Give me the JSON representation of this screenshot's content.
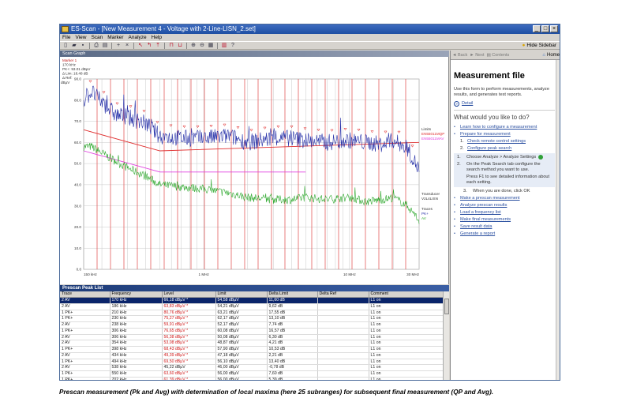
{
  "window": {
    "title": "ES-Scan - [New Measurement 4 - Voltage with 2-Line-LISN_2.set]",
    "menu": [
      "File",
      "View",
      "Scan",
      "Marker",
      "Analyze",
      "Help"
    ],
    "hide_sidebar": "Hide Sidebar"
  },
  "scan_graph": {
    "title": "Scan Graph",
    "marker": {
      "name": "Marker 1",
      "freq": "170 kHz",
      "value": "PK+: 93.01 dBµV",
      "delta": "Δ Lim: 18.48 dB",
      "ref": "Δ Ref:"
    },
    "y_unit": "dBµV",
    "limits_title": "Limits",
    "limit1": "EN55011MQP",
    "limit2": "EN55011MAV",
    "transducer_title": "Transducer",
    "transducer_name": "V2L4LISN",
    "traces_title": "Traces",
    "trace1": "PK+",
    "trace2": "AV",
    "colors": {
      "pk": "#2630a8",
      "av": "#2ea82e",
      "limit_qp": "#e03030",
      "limit_av": "#e040e0",
      "subrange": "#e04848",
      "grid": "#c8c8c8"
    }
  },
  "chart_data": {
    "type": "line",
    "xlabel": "",
    "ylabel": "dBµV",
    "x_scale": "log",
    "xlim": [
      150000,
      30000000
    ],
    "ylim": [
      0,
      90
    ],
    "x_ticks": [
      "150 kHz",
      "1 MHz",
      "10 MHz",
      "30 MHz"
    ],
    "y_ticks": [
      "0.0",
      "10.0",
      "20.0",
      "30.0",
      "40.0",
      "50.0",
      "60.0",
      "70.0",
      "80.0",
      "90.0"
    ],
    "series": [
      {
        "name": "PK+",
        "x": [
          150000,
          170000,
          200000,
          250000,
          300000,
          400000,
          500000,
          700000,
          1000000,
          1500000,
          2000000,
          3000000,
          4000000,
          5000000,
          7000000,
          10000000,
          13000000,
          17000000,
          20000000,
          25000000,
          30000000
        ],
        "y": [
          80,
          84,
          79,
          73,
          72,
          69,
          63,
          62,
          62,
          63,
          60,
          62,
          62,
          61,
          60,
          61,
          60,
          59,
          61,
          57,
          47
        ]
      },
      {
        "name": "AV",
        "x": [
          150000,
          170000,
          200000,
          250000,
          300000,
          400000,
          500000,
          700000,
          1000000,
          1500000,
          2000000,
          3000000,
          4000000,
          5000000,
          7000000,
          10000000,
          13000000,
          17000000,
          20000000,
          25000000,
          30000000
        ],
        "y": [
          58,
          58,
          55,
          51,
          48,
          44,
          40,
          39,
          38,
          36,
          34,
          33,
          33,
          34,
          33,
          34,
          32,
          33,
          34,
          30,
          23
        ]
      },
      {
        "name": "EN55011MQP",
        "x": [
          150000,
          500000,
          500000,
          30000000
        ],
        "y": [
          66,
          56,
          56,
          60
        ]
      },
      {
        "name": "EN55011MAV",
        "x": [
          150000,
          500000,
          500000,
          5000000
        ],
        "y": [
          56,
          46,
          46,
          46
        ]
      }
    ]
  },
  "peak_list": {
    "title": "Prescan Peak List",
    "columns": [
      "Trace",
      "Frequency",
      "Level",
      "Limit",
      "Delta Limit",
      "Delta Ref",
      "Comment"
    ],
    "rows": [
      [
        "2 AV",
        "170 kHz",
        "66,18 dBµV *",
        "54,58 dBµV",
        "11,60 dB",
        "",
        "L1 on"
      ],
      [
        "2 AV",
        "186 kHz",
        "63,83 dBµV *",
        "54,21 dBµV",
        "9,62 dB",
        "",
        "L1 on"
      ],
      [
        "1 PK+",
        "210 kHz",
        "80,76 dBµV *",
        "63,21 dBµV",
        "17,55 dB",
        "",
        "L1 on"
      ],
      [
        "1 PK+",
        "230 kHz",
        "75,27 dBµV *",
        "62,17 dBµV",
        "13,10 dB",
        "",
        "L1 on"
      ],
      [
        "2 AV",
        "238 kHz",
        "59,91 dBµV *",
        "52,17 dBµV",
        "7,74 dB",
        "",
        "L1 on"
      ],
      [
        "1 PK+",
        "306 kHz",
        "76,65 dBµV *",
        "60,08 dBµV",
        "16,57 dB",
        "",
        "L1 on"
      ],
      [
        "2 AV",
        "306 kHz",
        "56,38 dBµV *",
        "50,08 dBµV",
        "6,30 dB",
        "",
        "L1 on"
      ],
      [
        "2 AV",
        "354 kHz",
        "53,08 dBµV *",
        "48,87 dBµV",
        "4,21 dB",
        "",
        "L1 on"
      ],
      [
        "1 PK+",
        "398 kHz",
        "68,43 dBµV *",
        "57,90 dBµV",
        "10,53 dB",
        "",
        "L1 on"
      ],
      [
        "2 AV",
        "434 kHz",
        "49,39 dBµV *",
        "47,18 dBµV",
        "2,21 dB",
        "",
        "L1 on"
      ],
      [
        "1 PK+",
        "494 kHz",
        "69,50 dBµV *",
        "56,10 dBµV",
        "13,40 dB",
        "",
        "L1 on"
      ],
      [
        "2 AV",
        "538 kHz",
        "45,22 dBµV",
        "46,00 dBµV",
        "-0,78 dB",
        "",
        "L1 on"
      ],
      [
        "1 PK+",
        "550 kHz",
        "63,60 dBµV *",
        "56,00 dBµV",
        "7,60 dB",
        "",
        "L1 on"
      ],
      [
        "1 PK+",
        "702 kHz",
        "61,39 dBµV *",
        "56,00 dBµV",
        "5,39 dB",
        "",
        "L1 on"
      ],
      [
        "1 PK+",
        "938 kHz",
        "62,58 dBµV *",
        "56,00 dBµV",
        "6,58 dB",
        "",
        "L1 on"
      ]
    ]
  },
  "sidebar": {
    "nav": [
      "Back",
      "Next",
      "Contents"
    ],
    "home": "Home",
    "title": "Measurement file",
    "intro": "Use this form to perform measurements, analyze results, and generates test reports.",
    "detail": "Detail",
    "what_title": "What would you like to do?",
    "learn": "Learn how to configure a measurement",
    "prepare": "Prepare for measurement",
    "check_remote": "Check remote control settings",
    "configure_peak": "Configure peak search",
    "sub1": "Choose Analyze > Analyze Settings",
    "sub2a": "On the Peak Search tab configure the search method you want to use.",
    "sub2b": "Press F1 to see detailed information about each setting.",
    "sub3": "When you are done, click OK",
    "prescan": "Make a prescan measurement",
    "analyze": "Analyze prescan results",
    "load_list": "Load a frequency list",
    "final": "Make final measurements",
    "save": "Save result data",
    "report": "Generate a report"
  },
  "caption": "Prescan measurement (Pk and Avg) with determination of local maxima (here 25 subranges) for subsequent final measurement (QP and Avg)."
}
